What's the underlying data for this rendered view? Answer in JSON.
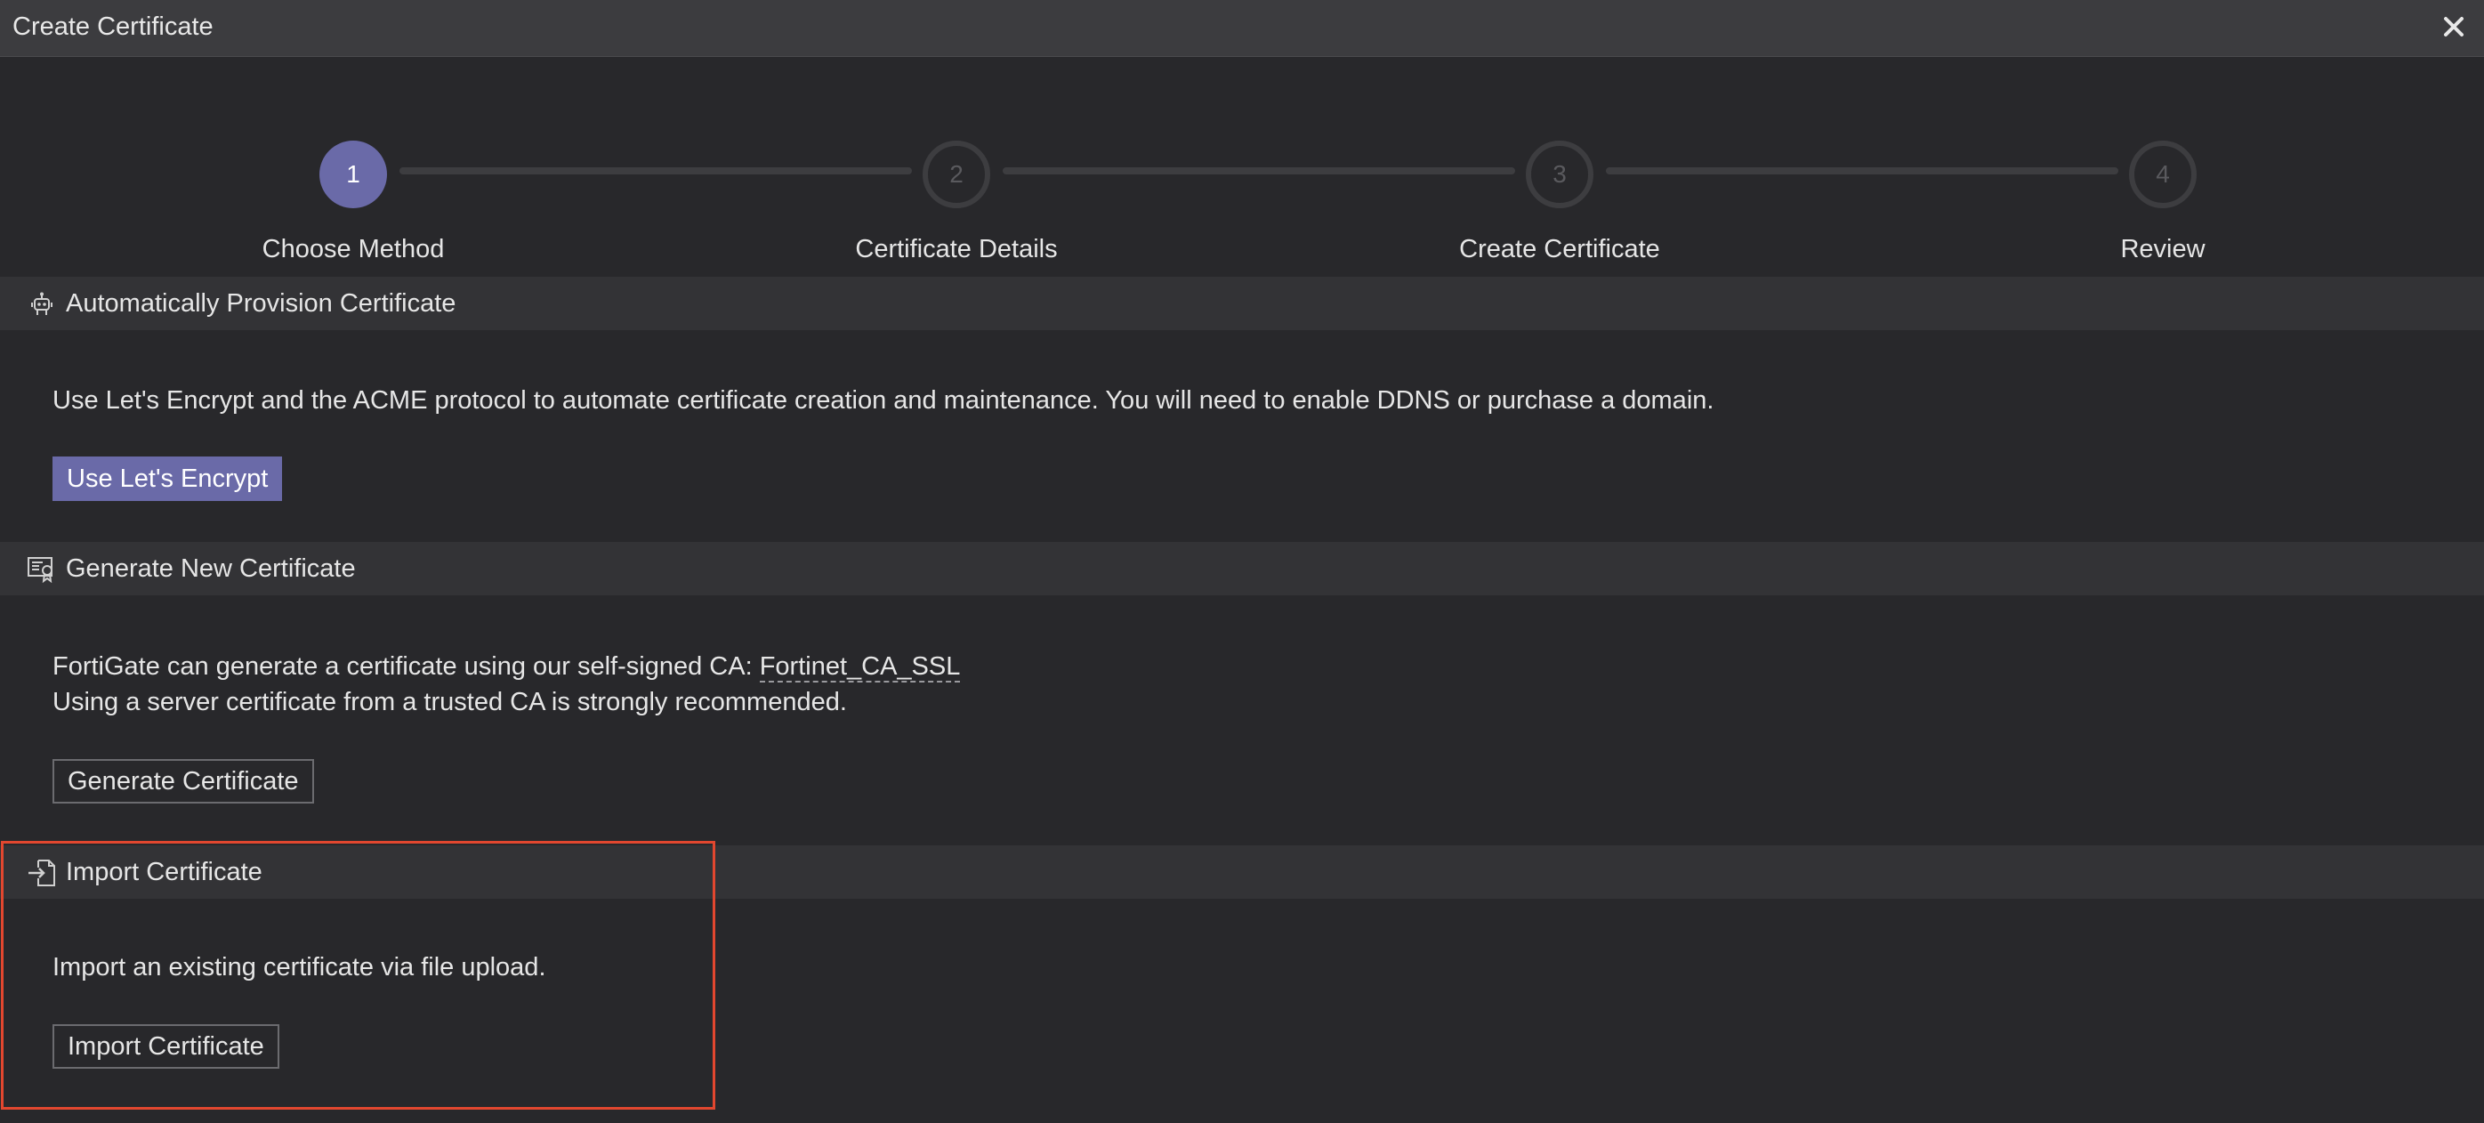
{
  "dialog": {
    "title": "Create Certificate",
    "close_icon": "close-icon"
  },
  "stepper": {
    "current_step": 1,
    "steps": [
      {
        "number": "1",
        "label": "Choose Method",
        "state": "active"
      },
      {
        "number": "2",
        "label": "Certificate Details",
        "state": "inactive"
      },
      {
        "number": "3",
        "label": "Create Certificate",
        "state": "inactive"
      },
      {
        "number": "4",
        "label": "Review",
        "state": "inactive"
      }
    ]
  },
  "sections": {
    "auto": {
      "title": "Automatically Provision Certificate",
      "icon": "robot-icon",
      "description": "Use Let's Encrypt and the ACME protocol to automate certificate creation and maintenance. You will need to enable DDNS or purchase a domain.",
      "button": "Use Let's Encrypt"
    },
    "generate": {
      "title": "Generate New Certificate",
      "icon": "certificate-icon",
      "description_prefix": "FortiGate can generate a certificate using our self-signed CA: ",
      "ca_name": "Fortinet_CA_SSL",
      "description_line2": "Using a server certificate from a trusted CA is strongly recommended.",
      "button": "Generate Certificate"
    },
    "import": {
      "title": "Import Certificate",
      "icon": "file-import-icon",
      "description": "Import an existing certificate via file upload.",
      "button": "Import Certificate"
    }
  },
  "colors": {
    "accent": "#6a6aa8",
    "highlight": "#e2472f",
    "background": "#28282b",
    "header": "#333336"
  }
}
